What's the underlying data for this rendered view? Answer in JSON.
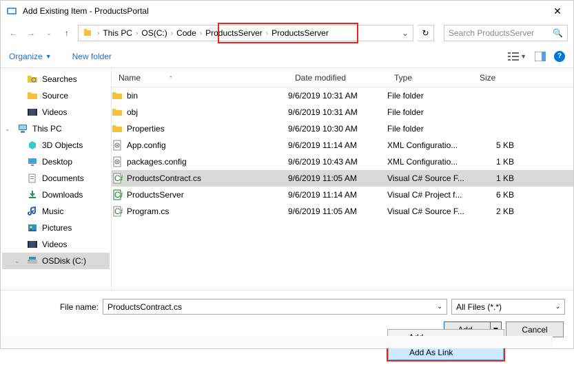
{
  "window": {
    "title": "Add Existing Item - ProductsPortal"
  },
  "breadcrumb": {
    "segments": [
      "This PC",
      "OS(C:)",
      "Code",
      "ProductsServer",
      "ProductsServer"
    ]
  },
  "search": {
    "placeholder": "Search ProductsServer"
  },
  "toolbar": {
    "organize": "Organize",
    "newfolder": "New folder"
  },
  "tree": {
    "items": [
      {
        "label": "Searches",
        "icon": "search-folder",
        "lvl": 1
      },
      {
        "label": "Source",
        "icon": "folder",
        "lvl": 1
      },
      {
        "label": "Videos",
        "icon": "videos",
        "lvl": 1
      },
      {
        "label": "This PC",
        "icon": "thispc",
        "lvl": 0,
        "exp": true
      },
      {
        "label": "3D Objects",
        "icon": "3d",
        "lvl": 1
      },
      {
        "label": "Desktop",
        "icon": "desktop",
        "lvl": 1
      },
      {
        "label": "Documents",
        "icon": "documents",
        "lvl": 1
      },
      {
        "label": "Downloads",
        "icon": "downloads",
        "lvl": 1
      },
      {
        "label": "Music",
        "icon": "music",
        "lvl": 1
      },
      {
        "label": "Pictures",
        "icon": "pictures",
        "lvl": 1
      },
      {
        "label": "Videos",
        "icon": "videos",
        "lvl": 1
      },
      {
        "label": "OSDisk (C:)",
        "icon": "drive",
        "lvl": 1,
        "sel": true,
        "exp": true
      }
    ]
  },
  "columns": {
    "name": "Name",
    "date": "Date modified",
    "type": "Type",
    "size": "Size"
  },
  "files": [
    {
      "name": "bin",
      "date": "9/6/2019 10:31 AM",
      "type": "File folder",
      "size": "",
      "icon": "folder"
    },
    {
      "name": "obj",
      "date": "9/6/2019 10:31 AM",
      "type": "File folder",
      "size": "",
      "icon": "folder"
    },
    {
      "name": "Properties",
      "date": "9/6/2019 10:30 AM",
      "type": "File folder",
      "size": "",
      "icon": "folder"
    },
    {
      "name": "App.config",
      "date": "9/6/2019 11:14 AM",
      "type": "XML Configuratio...",
      "size": "5 KB",
      "icon": "config"
    },
    {
      "name": "packages.config",
      "date": "9/6/2019 10:43 AM",
      "type": "XML Configuratio...",
      "size": "1 KB",
      "icon": "config"
    },
    {
      "name": "ProductsContract.cs",
      "date": "9/6/2019 11:05 AM",
      "type": "Visual C# Source F...",
      "size": "1 KB",
      "icon": "cs",
      "sel": true
    },
    {
      "name": "ProductsServer",
      "date": "9/6/2019 11:14 AM",
      "type": "Visual C# Project f...",
      "size": "6 KB",
      "icon": "csproj"
    },
    {
      "name": "Program.cs",
      "date": "9/6/2019 11:05 AM",
      "type": "Visual C# Source F...",
      "size": "2 KB",
      "icon": "cs"
    }
  ],
  "filename": {
    "label": "File name:",
    "value": "ProductsContract.cs"
  },
  "filter": {
    "value": "All Files (*.*)"
  },
  "buttons": {
    "add": "Add",
    "cancel": "Cancel"
  },
  "dropdown": {
    "items": [
      "Add",
      "Add As Link"
    ]
  }
}
